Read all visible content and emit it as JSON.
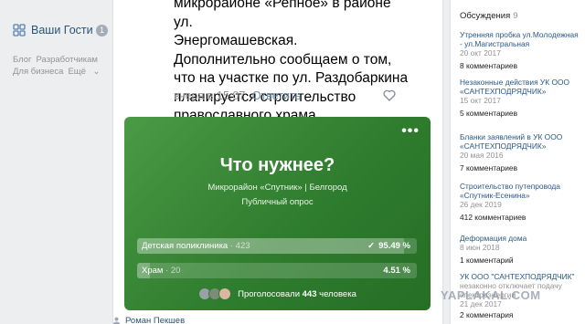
{
  "left_nav": {
    "guests_label": "Ваши Гости",
    "guests_count": "1",
    "footer_links": [
      "Блог",
      "Разработчикам",
      "Для бизнеса",
      "Ещё"
    ]
  },
  "post": {
    "text_lines": [
      "микрорайоне «Репное» в районе ул.",
      "Энергомашевская.",
      "Дополнительно сообщаем о том,",
      "что на участке по ул. Раздобаркина",
      "планируется строительство",
      "православного храма."
    ],
    "time": "вчера в 15:07",
    "reply_label": "Ответить",
    "next_author": "Роман Пекшев"
  },
  "poll": {
    "menu": "•••",
    "question": "Что нужнее?",
    "subtitle": "Микрорайон «Спутник» | Белгород",
    "type": "Публичный опрос",
    "options": [
      {
        "name": "Детская поликлиника",
        "votes": "423",
        "percent": "95.49 %",
        "share": 0.9549,
        "checked": true
      },
      {
        "name": "Храм",
        "votes": "20",
        "percent": "4.51 %",
        "share": 0.0451,
        "checked": false
      }
    ],
    "voted_prefix": "Проголосовали",
    "voted_count": "443",
    "voted_suffix": "человека"
  },
  "discussions": {
    "title": "Обсуждения",
    "count": "9",
    "items": [
      {
        "title": "Утренняя пробка ул.Молодежная - ул.Магистральная",
        "date": "20 окт 2017",
        "comments": "8 комментариев"
      },
      {
        "title": "Незаконные действия УК ООО «САНТЕХПОДРЯДЧИК»",
        "date": "15 окт 2017",
        "comments": "5 комментариев"
      },
      {
        "title": "Бланки заявлений в УК ООО «САНТЕХПОДРЯДЧИК»",
        "date": "20 мая 2016",
        "comments": "7 комментариев"
      },
      {
        "title": "Строительство путепровода «Спутник-Есенина»",
        "date": "26 дек 2019",
        "comments": "412 комментариев"
      },
      {
        "title": "Деформация дома",
        "date": "8 июн 2018",
        "comments": "1 комментарий"
      },
      {
        "title": "УК ООО \"САНТЕХПОДРЯДЧИК\"",
        "extra": "незаконно отключает подачу электроэнергии",
        "date": "21 дек 2017",
        "comments": "2 комментария"
      }
    ]
  },
  "watermark": "YAPLAKAL.COM"
}
